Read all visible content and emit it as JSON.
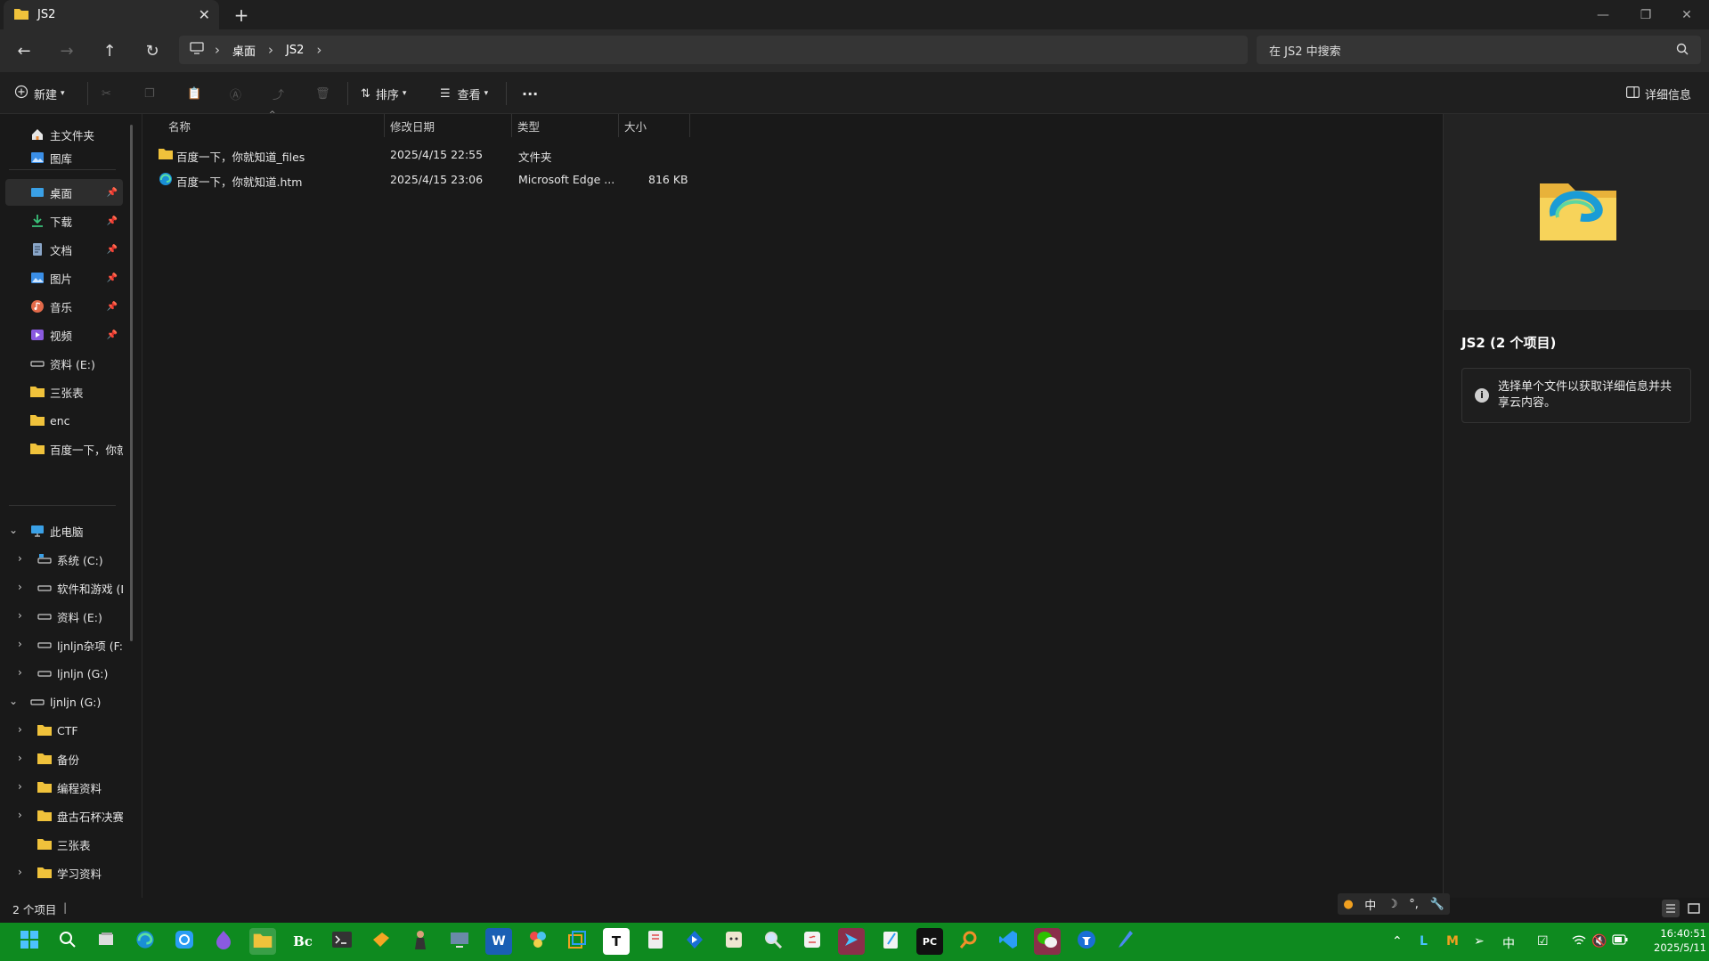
{
  "window": {
    "tab_title": "JS2",
    "close_tab": "✕",
    "new_tab": "+",
    "minimize": "—",
    "restore": "❐",
    "close": "✕"
  },
  "address": {
    "crumbs": [
      "桌面",
      "JS2"
    ],
    "search_placeholder": "在 JS2 中搜索"
  },
  "toolbar": {
    "new_label": "新建",
    "sort_label": "排序",
    "view_label": "查看",
    "more_label": "···",
    "details_label": "详细信息"
  },
  "sidebar": {
    "quick": [
      {
        "label": "主文件夹",
        "icon": "home-icon"
      },
      {
        "label": "图库",
        "icon": "gallery-icon"
      }
    ],
    "pinned": [
      {
        "label": "桌面",
        "icon": "desktop-icon",
        "pinned": true
      },
      {
        "label": "下载",
        "icon": "download-icon",
        "pinned": true
      },
      {
        "label": "文档",
        "icon": "document-icon",
        "pinned": true
      },
      {
        "label": "图片",
        "icon": "pictures-icon",
        "pinned": true
      },
      {
        "label": "音乐",
        "icon": "music-icon",
        "pinned": true
      },
      {
        "label": "视频",
        "icon": "video-icon",
        "pinned": true
      },
      {
        "label": "资料 (E:)",
        "icon": "drive-icon",
        "pinned": false
      },
      {
        "label": "三张表",
        "icon": "folder-icon",
        "pinned": false
      },
      {
        "label": "enc",
        "icon": "folder-icon",
        "pinned": false
      },
      {
        "label": "百度一下，你就",
        "icon": "folder-icon",
        "pinned": false
      }
    ],
    "this_pc": "此电脑",
    "drives": [
      "系统 (C:)",
      "软件和游戏 (D",
      "资料 (E:)",
      "ljnljn杂项 (F:)",
      "ljnljn (G:)"
    ],
    "expanded_drive": "ljnljn (G:)",
    "folders": [
      {
        "label": "CTF",
        "chevron": true
      },
      {
        "label": "备份",
        "chevron": true
      },
      {
        "label": "编程资料",
        "chevron": true
      },
      {
        "label": "盘古石杯决赛",
        "chevron": true
      },
      {
        "label": "三张表",
        "chevron": false
      },
      {
        "label": "学习资料",
        "chevron": true
      }
    ]
  },
  "columns": {
    "name": "名称",
    "modified": "修改日期",
    "type": "类型",
    "size": "大小"
  },
  "files": [
    {
      "name": "百度一下，你就知道_files",
      "modified": "2025/4/15 22:55",
      "type": "文件夹",
      "size": "",
      "icon": "folder-icon"
    },
    {
      "name": "百度一下，你就知道.htm",
      "modified": "2025/4/15 23:06",
      "type": "Microsoft Edge ...",
      "size": "816 KB",
      "icon": "edge-icon"
    }
  ],
  "details": {
    "title": "JS2 (2 个项目)",
    "info": "选择单个文件以获取详细信息并共享云内容。"
  },
  "status": {
    "count": "2 个项目"
  },
  "ime": [
    "●",
    "中",
    "☽",
    "°,",
    "🔧"
  ],
  "taskbar": {
    "apps": [
      "start",
      "search",
      "task-view",
      "edge",
      "qq-browser",
      "app-purple",
      "file-explorer",
      "bc",
      "terminal",
      "sticky",
      "character",
      "remote",
      "word",
      "ppt-color",
      "multi",
      "typora",
      "snip",
      "arrow",
      "notepad-cat",
      "magnifier",
      "java",
      "vpn",
      "notepad",
      "pycharm",
      "everything",
      "vscode",
      "wechat",
      "tray-arrow",
      "pen"
    ],
    "tray_lang": "中",
    "time": "16:40:51",
    "date": "2025/5/11"
  },
  "colors": {
    "accent": "#0e8a1f",
    "folder": "#f0c23b"
  }
}
